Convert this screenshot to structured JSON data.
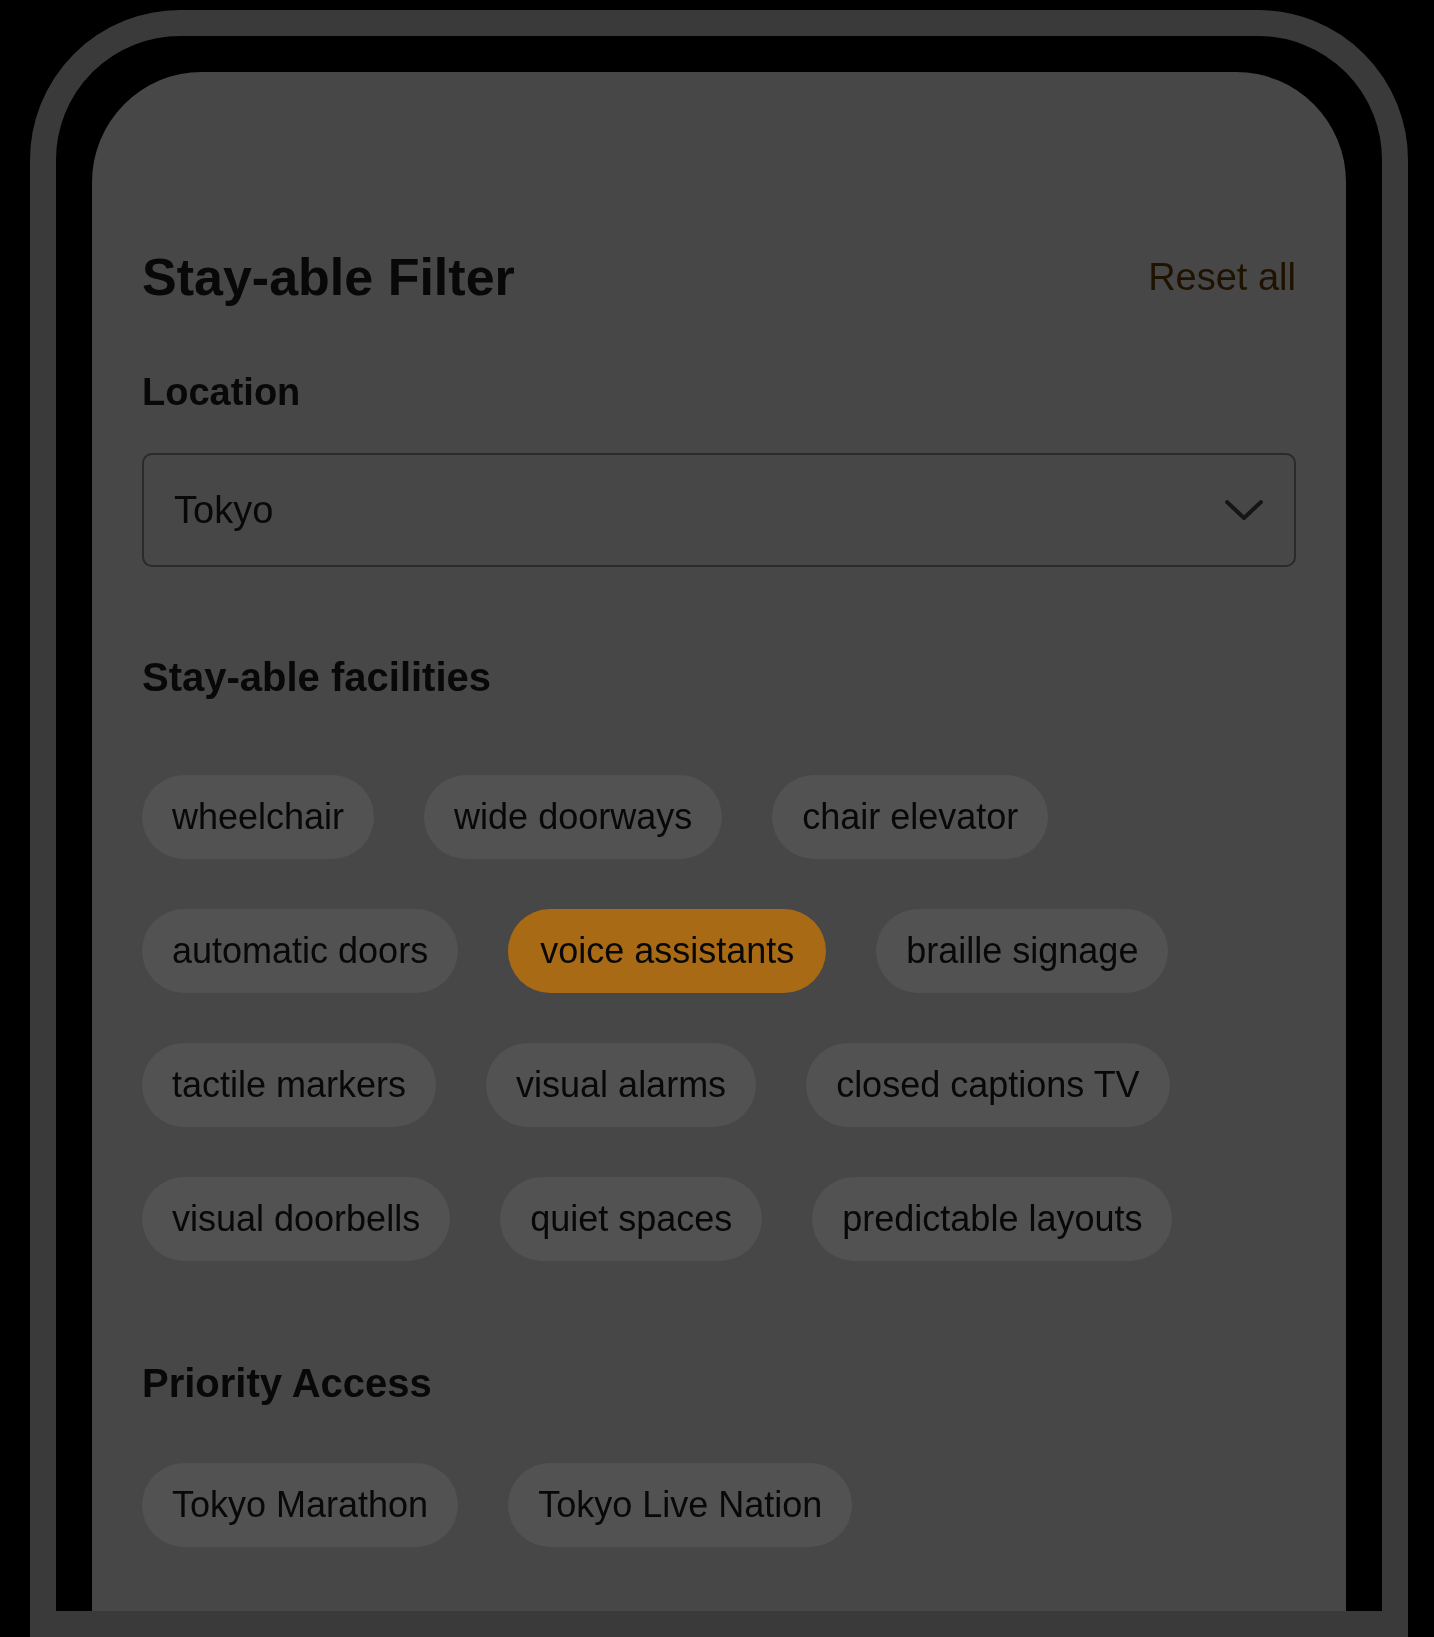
{
  "header": {
    "title": "Stay-able Filter",
    "reset": "Reset all"
  },
  "location": {
    "label": "Location",
    "value": "Tokyo"
  },
  "facilities": {
    "heading": "Stay-able facilities",
    "chips": [
      {
        "label": "wheelchair",
        "selected": false
      },
      {
        "label": "wide doorways",
        "selected": false
      },
      {
        "label": "chair elevator",
        "selected": false
      },
      {
        "label": "automatic doors",
        "selected": false
      },
      {
        "label": "voice assistants",
        "selected": true
      },
      {
        "label": "braille signage",
        "selected": false
      },
      {
        "label": "tactile markers",
        "selected": false
      },
      {
        "label": "visual alarms",
        "selected": false
      },
      {
        "label": "closed captions TV",
        "selected": false
      },
      {
        "label": "visual doorbells",
        "selected": false
      },
      {
        "label": "quiet spaces",
        "selected": false
      },
      {
        "label": "predictable layouts",
        "selected": false
      }
    ]
  },
  "priority": {
    "heading": "Priority Access",
    "chips": [
      {
        "label": "Tokyo Marathon",
        "selected": false
      },
      {
        "label": "Tokyo Live Nation",
        "selected": false
      }
    ]
  }
}
